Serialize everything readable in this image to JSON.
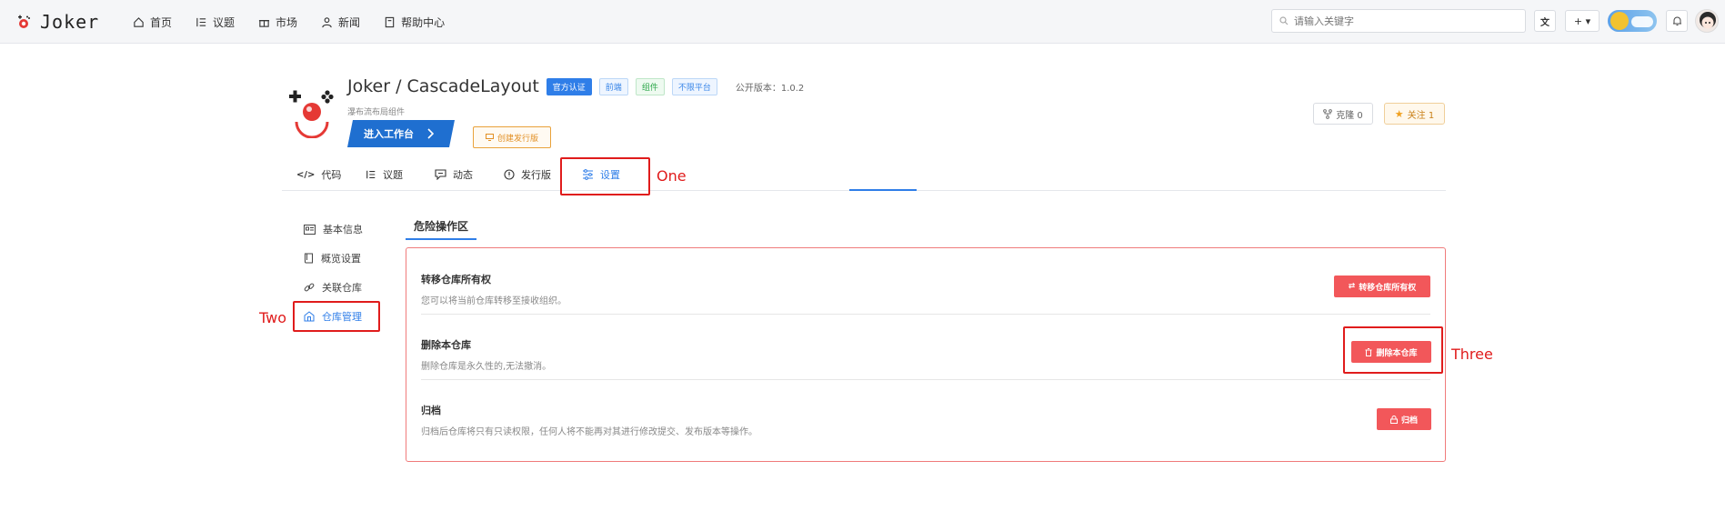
{
  "topbar": {
    "logo_text": "Joker",
    "nav": [
      {
        "label": "首页",
        "icon": "home-icon"
      },
      {
        "label": "议题",
        "icon": "issues-icon"
      },
      {
        "label": "市场",
        "icon": "market-icon"
      },
      {
        "label": "新闻",
        "icon": "news-icon"
      },
      {
        "label": "帮助中心",
        "icon": "help-icon"
      }
    ],
    "search_placeholder": "请输入关键字",
    "plus_label": "+ ▾"
  },
  "repo": {
    "title": "Joker / CascadeLayout",
    "tags": [
      "官方认证",
      "前端",
      "组件",
      "不限平台"
    ],
    "version_label": "公开版本：1.0.2",
    "description": "瀑布流布局组件",
    "enter_button": "进入工作台",
    "release_button": "创建发行版",
    "clone_label": "克隆 0",
    "follow_label": "关注 1"
  },
  "tabs": [
    {
      "label": "代码",
      "icon": "code-icon"
    },
    {
      "label": "议题",
      "icon": "issues-icon"
    },
    {
      "label": "动态",
      "icon": "activity-icon"
    },
    {
      "label": "发行版",
      "icon": "release-icon"
    },
    {
      "label": "设置",
      "icon": "settings-icon",
      "active": true
    }
  ],
  "side_menu": [
    {
      "label": "基本信息",
      "icon": "id-card-icon"
    },
    {
      "label": "概览设置",
      "icon": "book-icon"
    },
    {
      "label": "关联仓库",
      "icon": "link-icon"
    },
    {
      "label": "仓库管理",
      "icon": "repo-manage-icon",
      "active": true
    }
  ],
  "danger": {
    "section_title": "危险操作区",
    "rows": [
      {
        "title": "转移仓库所有权",
        "desc": "您可以将当前仓库转移至接收组织。",
        "button": "转移仓库所有权"
      },
      {
        "title": "删除本仓库",
        "desc": "删除仓库是永久性的,无法撤消。",
        "button": "删除本仓库"
      },
      {
        "title": "归档",
        "desc": "归档后仓库将只有只读权限，任何人将不能再对其进行修改提交、发布版本等操作。",
        "button": "归档"
      }
    ]
  },
  "annotations": [
    "One",
    "Two",
    "Three"
  ],
  "colors": {
    "accent": "#2f7ee8",
    "danger": "#f2575a",
    "annotation": "#e01c1c"
  }
}
